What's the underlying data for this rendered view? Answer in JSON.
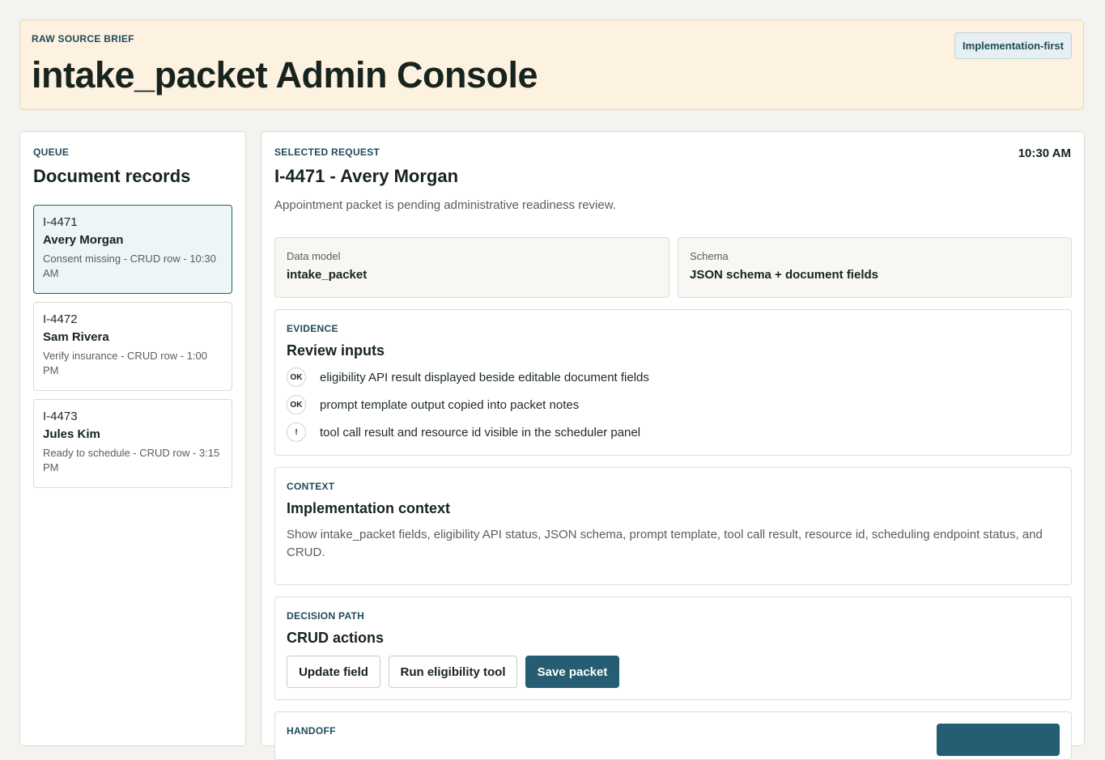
{
  "banner": {
    "eyebrow": "RAW SOURCE BRIEF",
    "title": "intake_packet Admin Console",
    "badge": "Implementation-first"
  },
  "queue": {
    "eyebrow": "QUEUE",
    "title": "Document records",
    "records": [
      {
        "id": "I-4471",
        "name": "Avery Morgan",
        "meta": "Consent missing - CRUD row - 10:30 AM",
        "selected": true
      },
      {
        "id": "I-4472",
        "name": "Sam Rivera",
        "meta": "Verify insurance - CRUD row - 1:00 PM",
        "selected": false
      },
      {
        "id": "I-4473",
        "name": "Jules Kim",
        "meta": "Ready to schedule - CRUD row - 3:15 PM",
        "selected": false
      }
    ]
  },
  "detail": {
    "eyebrow": "SELECTED REQUEST",
    "time": "10:30 AM",
    "title": "I-4471 - Avery Morgan",
    "summary": "Appointment packet is pending administrative readiness review.",
    "data_model": {
      "label": "Data model",
      "value": "intake_packet"
    },
    "schema": {
      "label": "Schema",
      "value": "JSON schema + document fields"
    },
    "evidence": {
      "eyebrow": "EVIDENCE",
      "title": "Review inputs",
      "items": [
        {
          "status": "OK",
          "text": "eligibility API result displayed beside editable document fields"
        },
        {
          "status": "OK",
          "text": "prompt template output copied into packet notes"
        },
        {
          "status": "!",
          "text": "tool call result and resource id visible in the scheduler panel"
        }
      ]
    },
    "context": {
      "eyebrow": "CONTEXT",
      "title": "Implementation context",
      "body": "Show intake_packet fields, eligibility API status, JSON schema, prompt template, tool call result, resource id, scheduling endpoint status, and CRUD."
    },
    "decision": {
      "eyebrow": "DECISION PATH",
      "title": "CRUD actions",
      "buttons": {
        "update": "Update field",
        "run": "Run eligibility tool",
        "save": "Save packet"
      }
    },
    "handoff": {
      "eyebrow": "HANDOFF"
    }
  },
  "colors": {
    "accent": "#255d72",
    "banner_bg": "#fdf1e0",
    "selected_bg": "#eef5f6",
    "page_bg": "#f4f3ef"
  }
}
